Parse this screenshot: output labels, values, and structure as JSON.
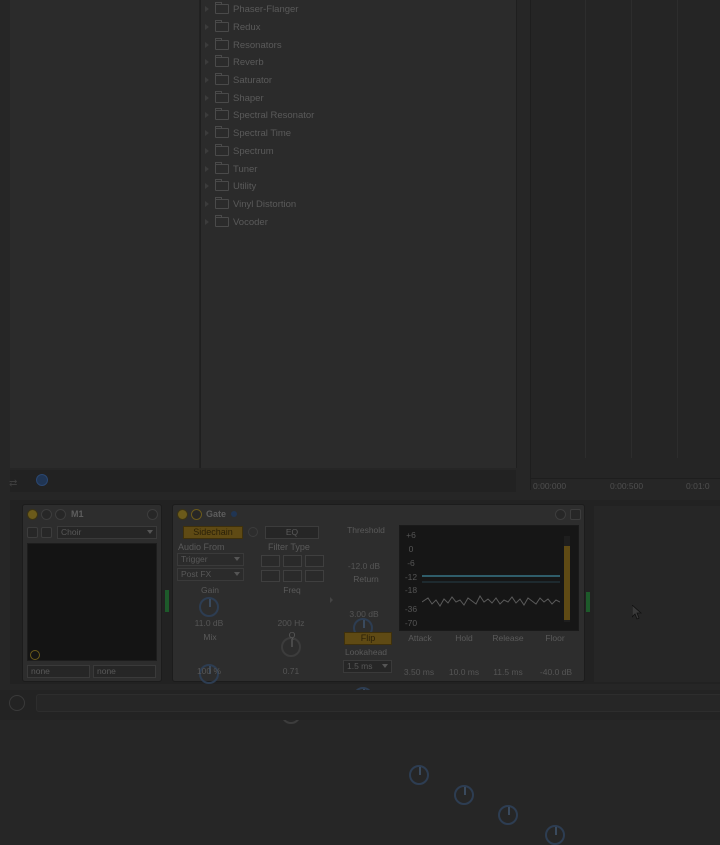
{
  "browser": {
    "items": [
      {
        "label": "Phaser-Flanger"
      },
      {
        "label": "Redux"
      },
      {
        "label": "Resonators"
      },
      {
        "label": "Reverb"
      },
      {
        "label": "Saturator"
      },
      {
        "label": "Shaper"
      },
      {
        "label": "Spectral Resonator"
      },
      {
        "label": "Spectral Time"
      },
      {
        "label": "Spectrum"
      },
      {
        "label": "Tuner"
      },
      {
        "label": "Utility"
      },
      {
        "label": "Vinyl Distortion"
      },
      {
        "label": "Vocoder"
      }
    ]
  },
  "arrangement": {
    "time_labels": [
      "0:00:000",
      "0:00:500",
      "0:01:0"
    ]
  },
  "m1_device": {
    "title": "M1",
    "preset": "Choir",
    "macro_left": "none",
    "macro_right": "none"
  },
  "gate_device": {
    "title": "Gate",
    "sidechain_label": "Sidechain",
    "eq_label": "EQ",
    "audio_from_label": "Audio From",
    "audio_from_value": "Trigger",
    "post_fx_value": "Post FX",
    "filter_type_label": "Filter Type",
    "gain_label": "Gain",
    "gain_value": "11.0 dB",
    "freq_label": "Freq",
    "freq_value": "200 Hz",
    "mix_label": "Mix",
    "mix_value": "100 %",
    "q_label": "Q",
    "q_value": "0.71",
    "threshold_label": "Threshold",
    "threshold_value": "-12.0 dB",
    "return_label": "Return",
    "return_value": "3.00 dB",
    "flip_label": "Flip",
    "lookahead_label": "Lookahead",
    "lookahead_value": "1.5 ms",
    "attack_label": "Attack",
    "attack_value": "3.50 ms",
    "hold_label": "Hold",
    "hold_value": "10.0 ms",
    "release_label": "Release",
    "release_value": "11.5 ms",
    "floor_label": "Floor",
    "floor_value": "-40.0 dB",
    "scale": [
      "+6",
      "0",
      "-6",
      "-12",
      "-18",
      "-36",
      "-70"
    ]
  },
  "colors": {
    "accent_orange": "#5f4a14",
    "meter_green": "#1d5a2a",
    "threshold_line": "#2f5d6a"
  }
}
